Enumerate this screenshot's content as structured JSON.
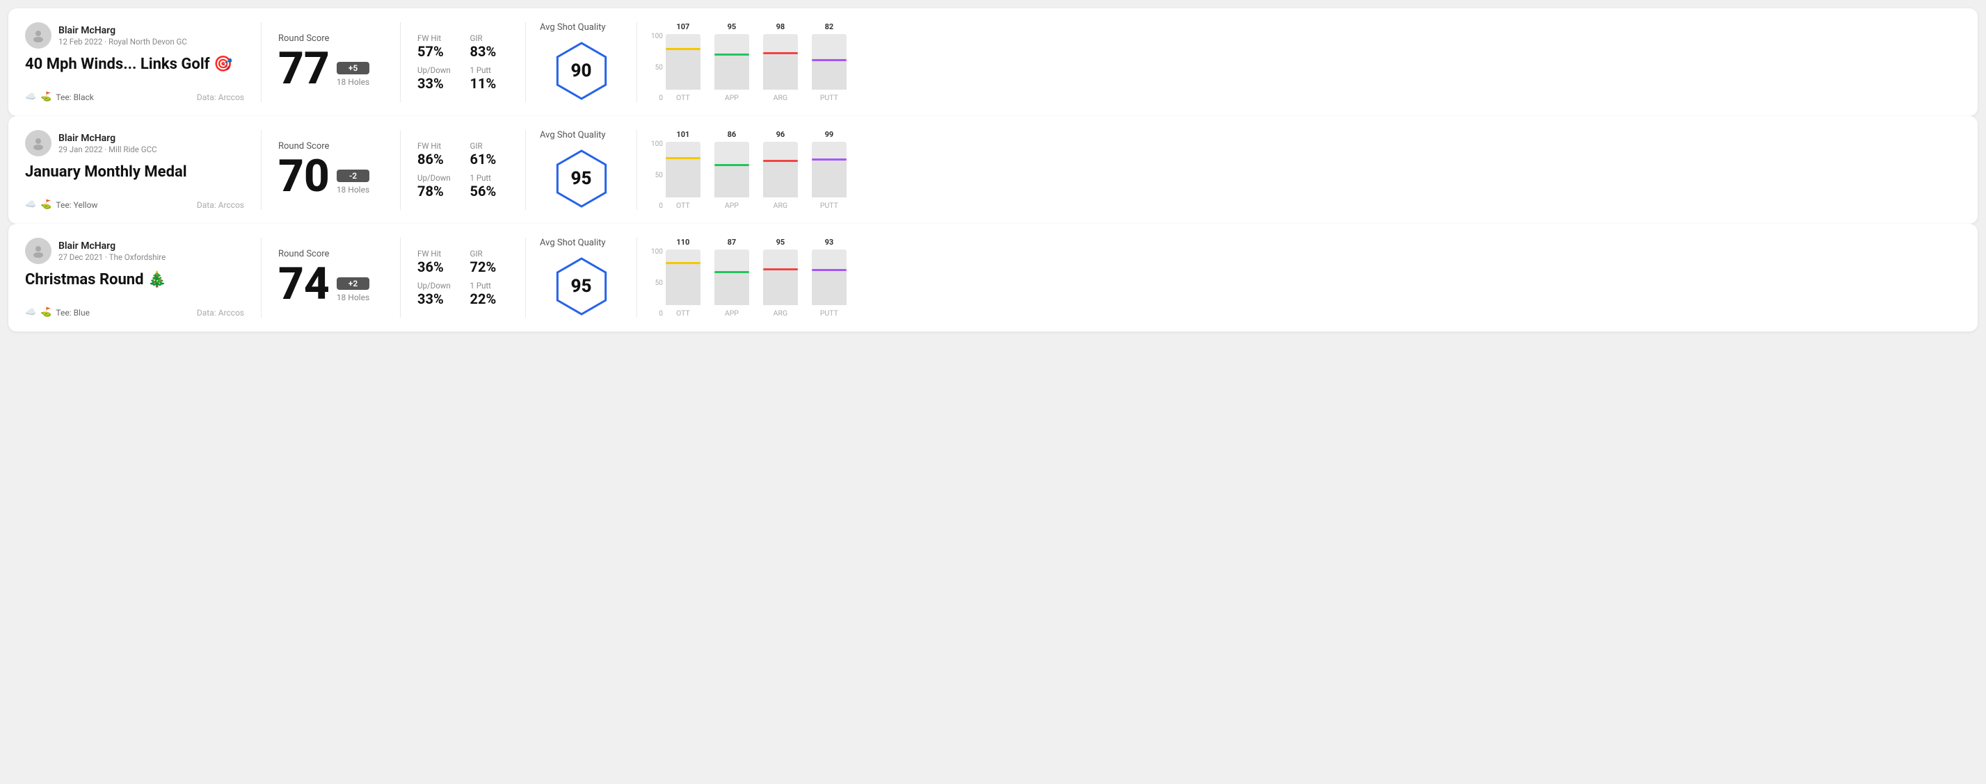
{
  "rounds": [
    {
      "id": "round1",
      "user": {
        "name": "Blair McHarg",
        "dateClub": "12 Feb 2022 · Royal North Devon GC",
        "tee": "Black",
        "dataSource": "Data: Arccos"
      },
      "title": "40 Mph Winds... Links Golf 🎯",
      "titleEmoji": "🎯",
      "score": 77,
      "scoreDiff": "+5",
      "holes": "18 Holes",
      "stats": {
        "fwHit": "57%",
        "gir": "83%",
        "upDown": "33%",
        "onePutt": "11%"
      },
      "avgShotQuality": 90,
      "chart": {
        "columns": [
          {
            "label": "OTT",
            "value": 107,
            "color": "#f5c800",
            "barPct": 0.75
          },
          {
            "label": "APP",
            "value": 95,
            "color": "#22c55e",
            "barPct": 0.65
          },
          {
            "label": "ARG",
            "value": 98,
            "color": "#ef4444",
            "barPct": 0.68
          },
          {
            "label": "PUTT",
            "value": 82,
            "color": "#a855f7",
            "barPct": 0.55
          }
        ],
        "yLabels": [
          "100",
          "50",
          "0"
        ]
      }
    },
    {
      "id": "round2",
      "user": {
        "name": "Blair McHarg",
        "dateClub": "29 Jan 2022 · Mill Ride GCC",
        "tee": "Yellow",
        "dataSource": "Data: Arccos"
      },
      "title": "January Monthly Medal",
      "titleEmoji": "",
      "score": 70,
      "scoreDiff": "-2",
      "holes": "18 Holes",
      "stats": {
        "fwHit": "86%",
        "gir": "61%",
        "upDown": "78%",
        "onePutt": "56%"
      },
      "avgShotQuality": 95,
      "chart": {
        "columns": [
          {
            "label": "OTT",
            "value": 101,
            "color": "#f5c800",
            "barPct": 0.72
          },
          {
            "label": "APP",
            "value": 86,
            "color": "#22c55e",
            "barPct": 0.6
          },
          {
            "label": "ARG",
            "value": 96,
            "color": "#ef4444",
            "barPct": 0.67
          },
          {
            "label": "PUTT",
            "value": 99,
            "color": "#a855f7",
            "barPct": 0.7
          }
        ],
        "yLabels": [
          "100",
          "50",
          "0"
        ]
      }
    },
    {
      "id": "round3",
      "user": {
        "name": "Blair McHarg",
        "dateClub": "27 Dec 2021 · The Oxfordshire",
        "tee": "Blue",
        "dataSource": "Data: Arccos"
      },
      "title": "Christmas Round 🎄",
      "titleEmoji": "🎄",
      "score": 74,
      "scoreDiff": "+2",
      "holes": "18 Holes",
      "stats": {
        "fwHit": "36%",
        "gir": "72%",
        "upDown": "33%",
        "onePutt": "22%"
      },
      "avgShotQuality": 95,
      "chart": {
        "columns": [
          {
            "label": "OTT",
            "value": 110,
            "color": "#f5c800",
            "barPct": 0.78
          },
          {
            "label": "APP",
            "value": 87,
            "color": "#22c55e",
            "barPct": 0.61
          },
          {
            "label": "ARG",
            "value": 95,
            "color": "#ef4444",
            "barPct": 0.66
          },
          {
            "label": "PUTT",
            "value": 93,
            "color": "#a855f7",
            "barPct": 0.65
          }
        ],
        "yLabels": [
          "100",
          "50",
          "0"
        ]
      }
    }
  ],
  "labels": {
    "roundScore": "Round Score",
    "fwHit": "FW Hit",
    "gir": "GIR",
    "upDown": "Up/Down",
    "onePutt": "1 Putt",
    "avgShotQuality": "Avg Shot Quality",
    "teePrefix": "Tee:",
    "dataArccos": "Data: Arccos"
  }
}
